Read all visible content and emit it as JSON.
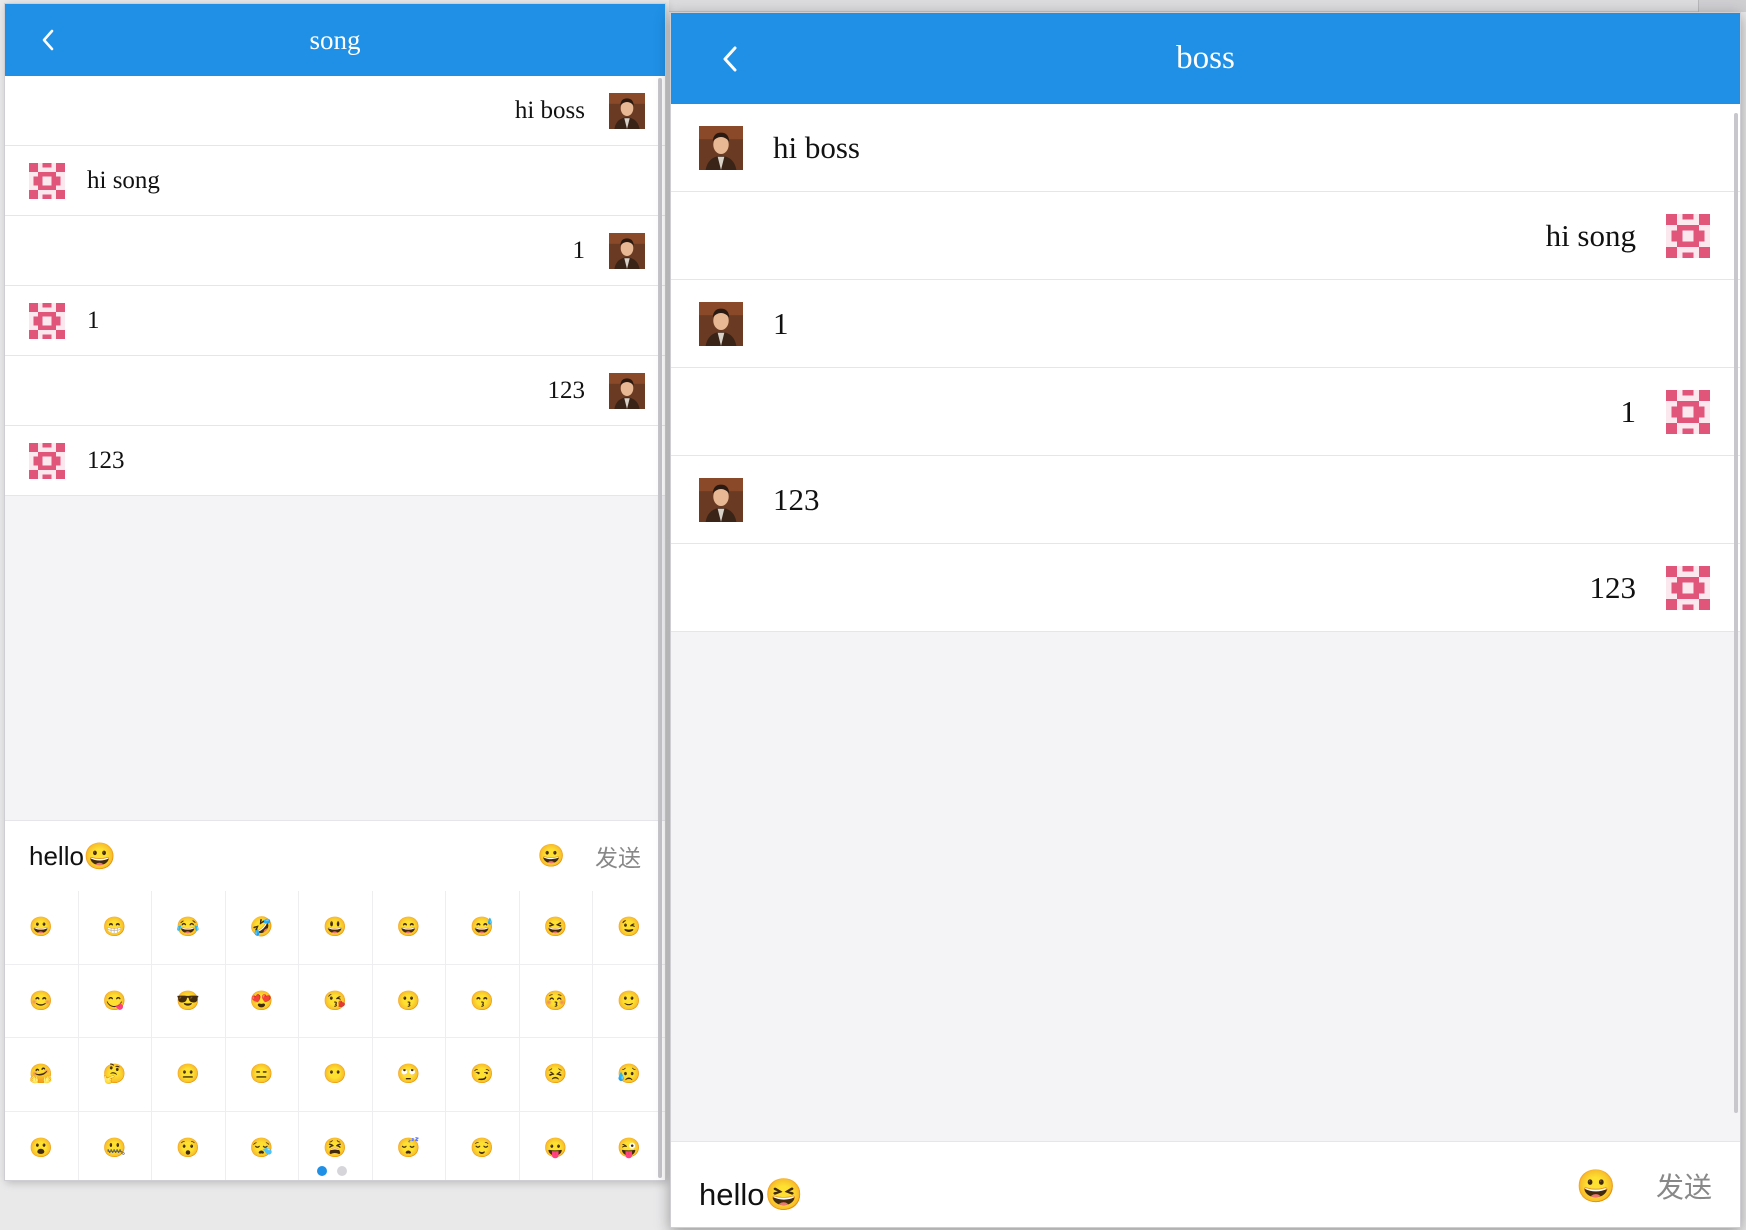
{
  "left_window": {
    "title": "song",
    "messages": [
      {
        "side": "me",
        "text": "hi boss",
        "avatar": "man-photo"
      },
      {
        "side": "other",
        "text": "hi song",
        "avatar": "pink-pattern"
      },
      {
        "side": "me",
        "text": "1",
        "avatar": "man-photo"
      },
      {
        "side": "other",
        "text": "1",
        "avatar": "pink-pattern"
      },
      {
        "side": "me",
        "text": "123",
        "avatar": "man-photo"
      },
      {
        "side": "other",
        "text": "123",
        "avatar": "pink-pattern"
      }
    ],
    "input_value": "hello😀",
    "emoji_button": "😀",
    "send_label": "发送",
    "emoji_grid": [
      "😀",
      "😁",
      "😂",
      "🤣",
      "😃",
      "😄",
      "😅",
      "😆",
      "😉",
      "😊",
      "😋",
      "😎",
      "😍",
      "😘",
      "😗",
      "😙",
      "😚",
      "🙂",
      "🤗",
      "🤔",
      "😐",
      "😑",
      "😶",
      "🙄",
      "😏",
      "😣",
      "😥",
      "😮",
      "🤐",
      "😯",
      "😪",
      "😫",
      "😴",
      "😌",
      "😛",
      "😜"
    ],
    "page_count": 2,
    "active_page": 1
  },
  "right_window": {
    "title": "boss",
    "messages": [
      {
        "side": "other",
        "text": "hi boss",
        "avatar": "man-photo"
      },
      {
        "side": "me",
        "text": "hi song",
        "avatar": "pink-pattern"
      },
      {
        "side": "other",
        "text": "1",
        "avatar": "man-photo"
      },
      {
        "side": "me",
        "text": "1",
        "avatar": "pink-pattern"
      },
      {
        "side": "other",
        "text": "123",
        "avatar": "man-photo"
      },
      {
        "side": "me",
        "text": "123",
        "avatar": "pink-pattern"
      }
    ],
    "input_value": "hello😆",
    "emoji_button": "😀",
    "send_label": "发送"
  },
  "colors": {
    "navbar": "#1f90e6",
    "background": "#f4f4f7",
    "avatar_pink": "#e2557a",
    "send_text": "#888888"
  }
}
